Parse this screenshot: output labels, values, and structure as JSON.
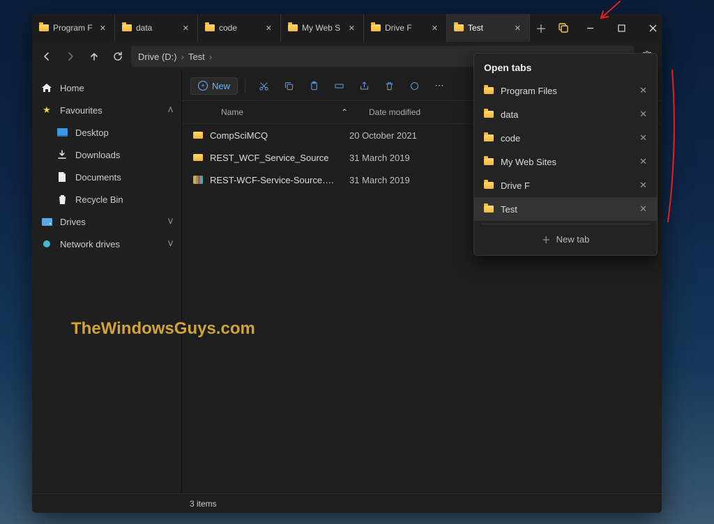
{
  "tabs": [
    {
      "label": "Program F",
      "active": false
    },
    {
      "label": "data",
      "active": false
    },
    {
      "label": "code",
      "active": false
    },
    {
      "label": "My Web S",
      "active": false
    },
    {
      "label": "Drive F",
      "active": false
    },
    {
      "label": "Test",
      "active": true
    }
  ],
  "address": {
    "segments": [
      "Drive (D:)",
      "Test"
    ]
  },
  "sidebar": {
    "home": "Home",
    "favourites": "Favourites",
    "fav_items": [
      "Desktop",
      "Downloads",
      "Documents",
      "Recycle Bin"
    ],
    "drives": "Drives",
    "network": "Network drives"
  },
  "toolbar": {
    "new_label": "New"
  },
  "columns": {
    "name": "Name",
    "date": "Date modified"
  },
  "rows": [
    {
      "type": "folder",
      "name": "CompSciMCQ",
      "date": "20 October 2021"
    },
    {
      "type": "folder",
      "name": "REST_WCF_Service_Source",
      "date": "31 March 2019"
    },
    {
      "type": "zip",
      "name": "REST-WCF-Service-Source….",
      "date": "31 March 2019"
    }
  ],
  "status": "3 items",
  "watermark": "TheWindowsGuys.com",
  "popup": {
    "title": "Open tabs",
    "items": [
      "Program Files",
      "data",
      "code",
      "My Web Sites",
      "Drive F",
      "Test"
    ],
    "active": "Test",
    "new_label": "New tab"
  }
}
